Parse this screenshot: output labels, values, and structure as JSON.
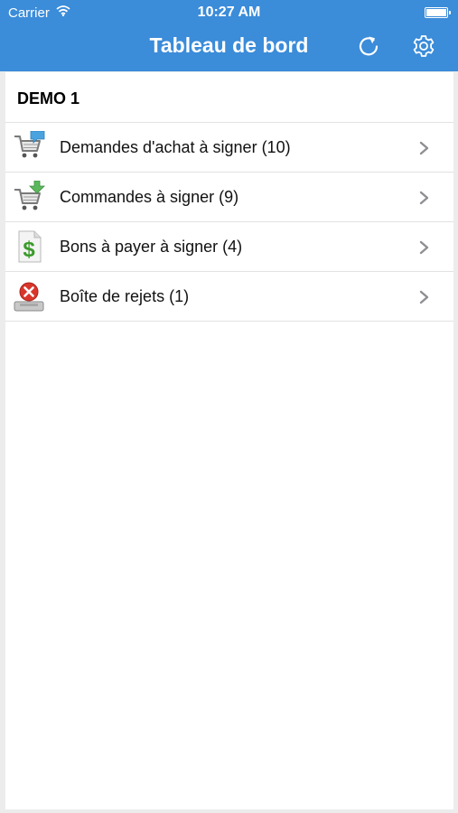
{
  "status_bar": {
    "carrier": "Carrier",
    "time": "10:27 AM"
  },
  "nav": {
    "title": "Tableau de bord",
    "refresh_icon": "refresh-icon",
    "settings_icon": "gear-icon"
  },
  "section": {
    "title": "DEMO 1",
    "items": [
      {
        "label": "Demandes d'achat à signer (10)",
        "icon": "cart-comment-icon"
      },
      {
        "label": "Commandes à signer (9)",
        "icon": "cart-add-icon"
      },
      {
        "label": "Bons à payer à signer (4)",
        "icon": "dollar-document-icon"
      },
      {
        "label": "Boîte de rejets (1)",
        "icon": "reject-inbox-icon"
      }
    ]
  },
  "colors": {
    "nav_background": "#3b8cd9",
    "page_background": "#ececec"
  }
}
